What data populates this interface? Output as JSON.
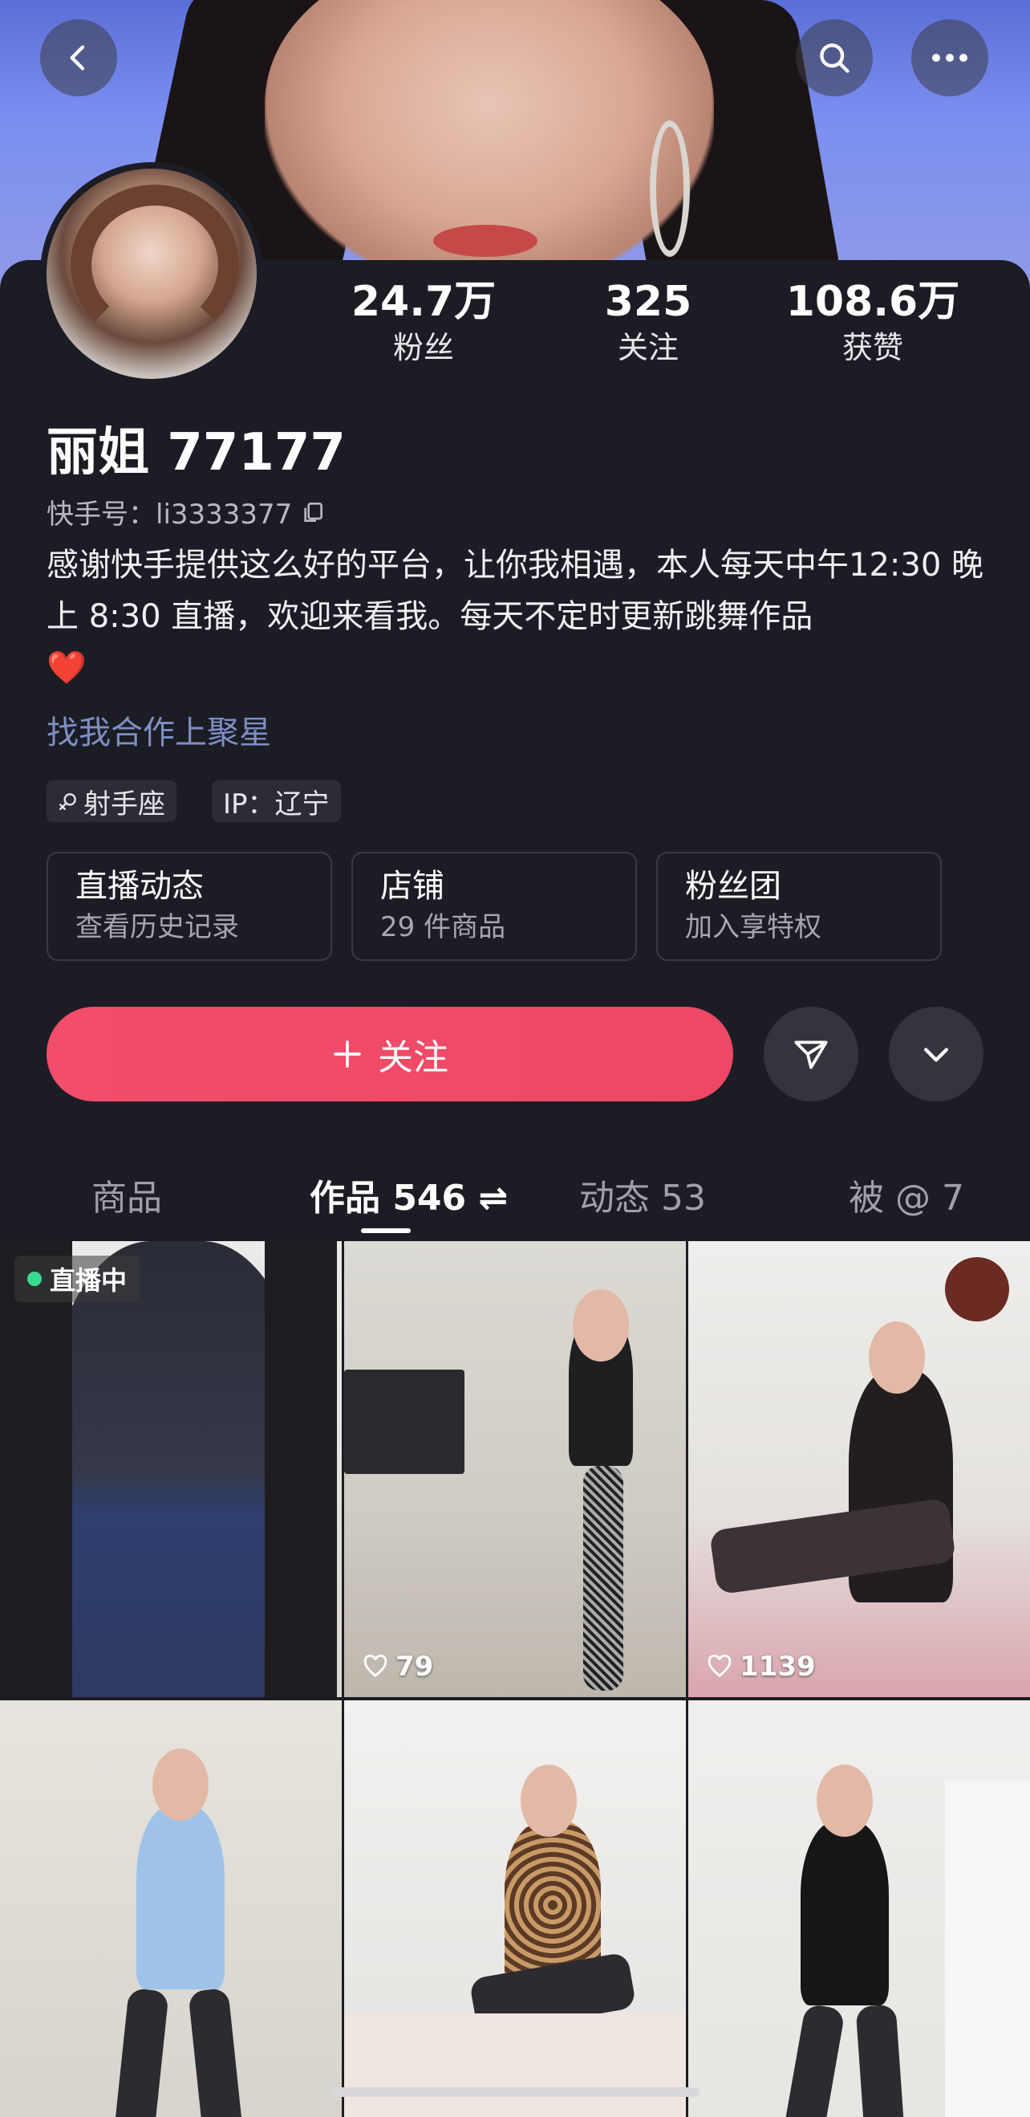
{
  "profile": {
    "name": "丽姐 77177",
    "kuaishou_id_label": "快手号：",
    "kuaishou_id": "li3333377",
    "bio": "感谢快手提供这么好的平台，让你我相遇，本人每天中午12:30 晚上 8:30 直播，欢迎来看我。每天不定时更新跳舞作品",
    "bio_emoji": "❤️",
    "cooperation_link": "找我合作上聚星",
    "tags": [
      {
        "icon": "female-sign-icon",
        "text": "射手座"
      },
      {
        "text": "IP：辽宁"
      }
    ]
  },
  "stats": [
    {
      "value": "24.7万",
      "label": "粉丝"
    },
    {
      "value": "325",
      "label": "关注"
    },
    {
      "value": "108.6万",
      "label": "获赞"
    }
  ],
  "cards": [
    {
      "title": "直播动态",
      "subtitle": "查看历史记录"
    },
    {
      "title": "店铺",
      "subtitle": "29 件商品"
    },
    {
      "title": "粉丝团",
      "subtitle": "加入享特权"
    }
  ],
  "actions": {
    "follow_label": "关注"
  },
  "tabs": [
    {
      "label": "商品"
    },
    {
      "label": "作品 546 ⇌",
      "active": true
    },
    {
      "label": "动态 53"
    },
    {
      "label": "被 @ 7"
    }
  ],
  "videos": [
    {
      "badge": "直播中"
    },
    {
      "likes": "79"
    },
    {
      "likes": "1139"
    },
    {},
    {},
    {}
  ],
  "colors": {
    "background": "#1c1c24",
    "follow_button": "#ef4a66",
    "link": "#7d8fc4",
    "live_dot": "#39d98a"
  }
}
